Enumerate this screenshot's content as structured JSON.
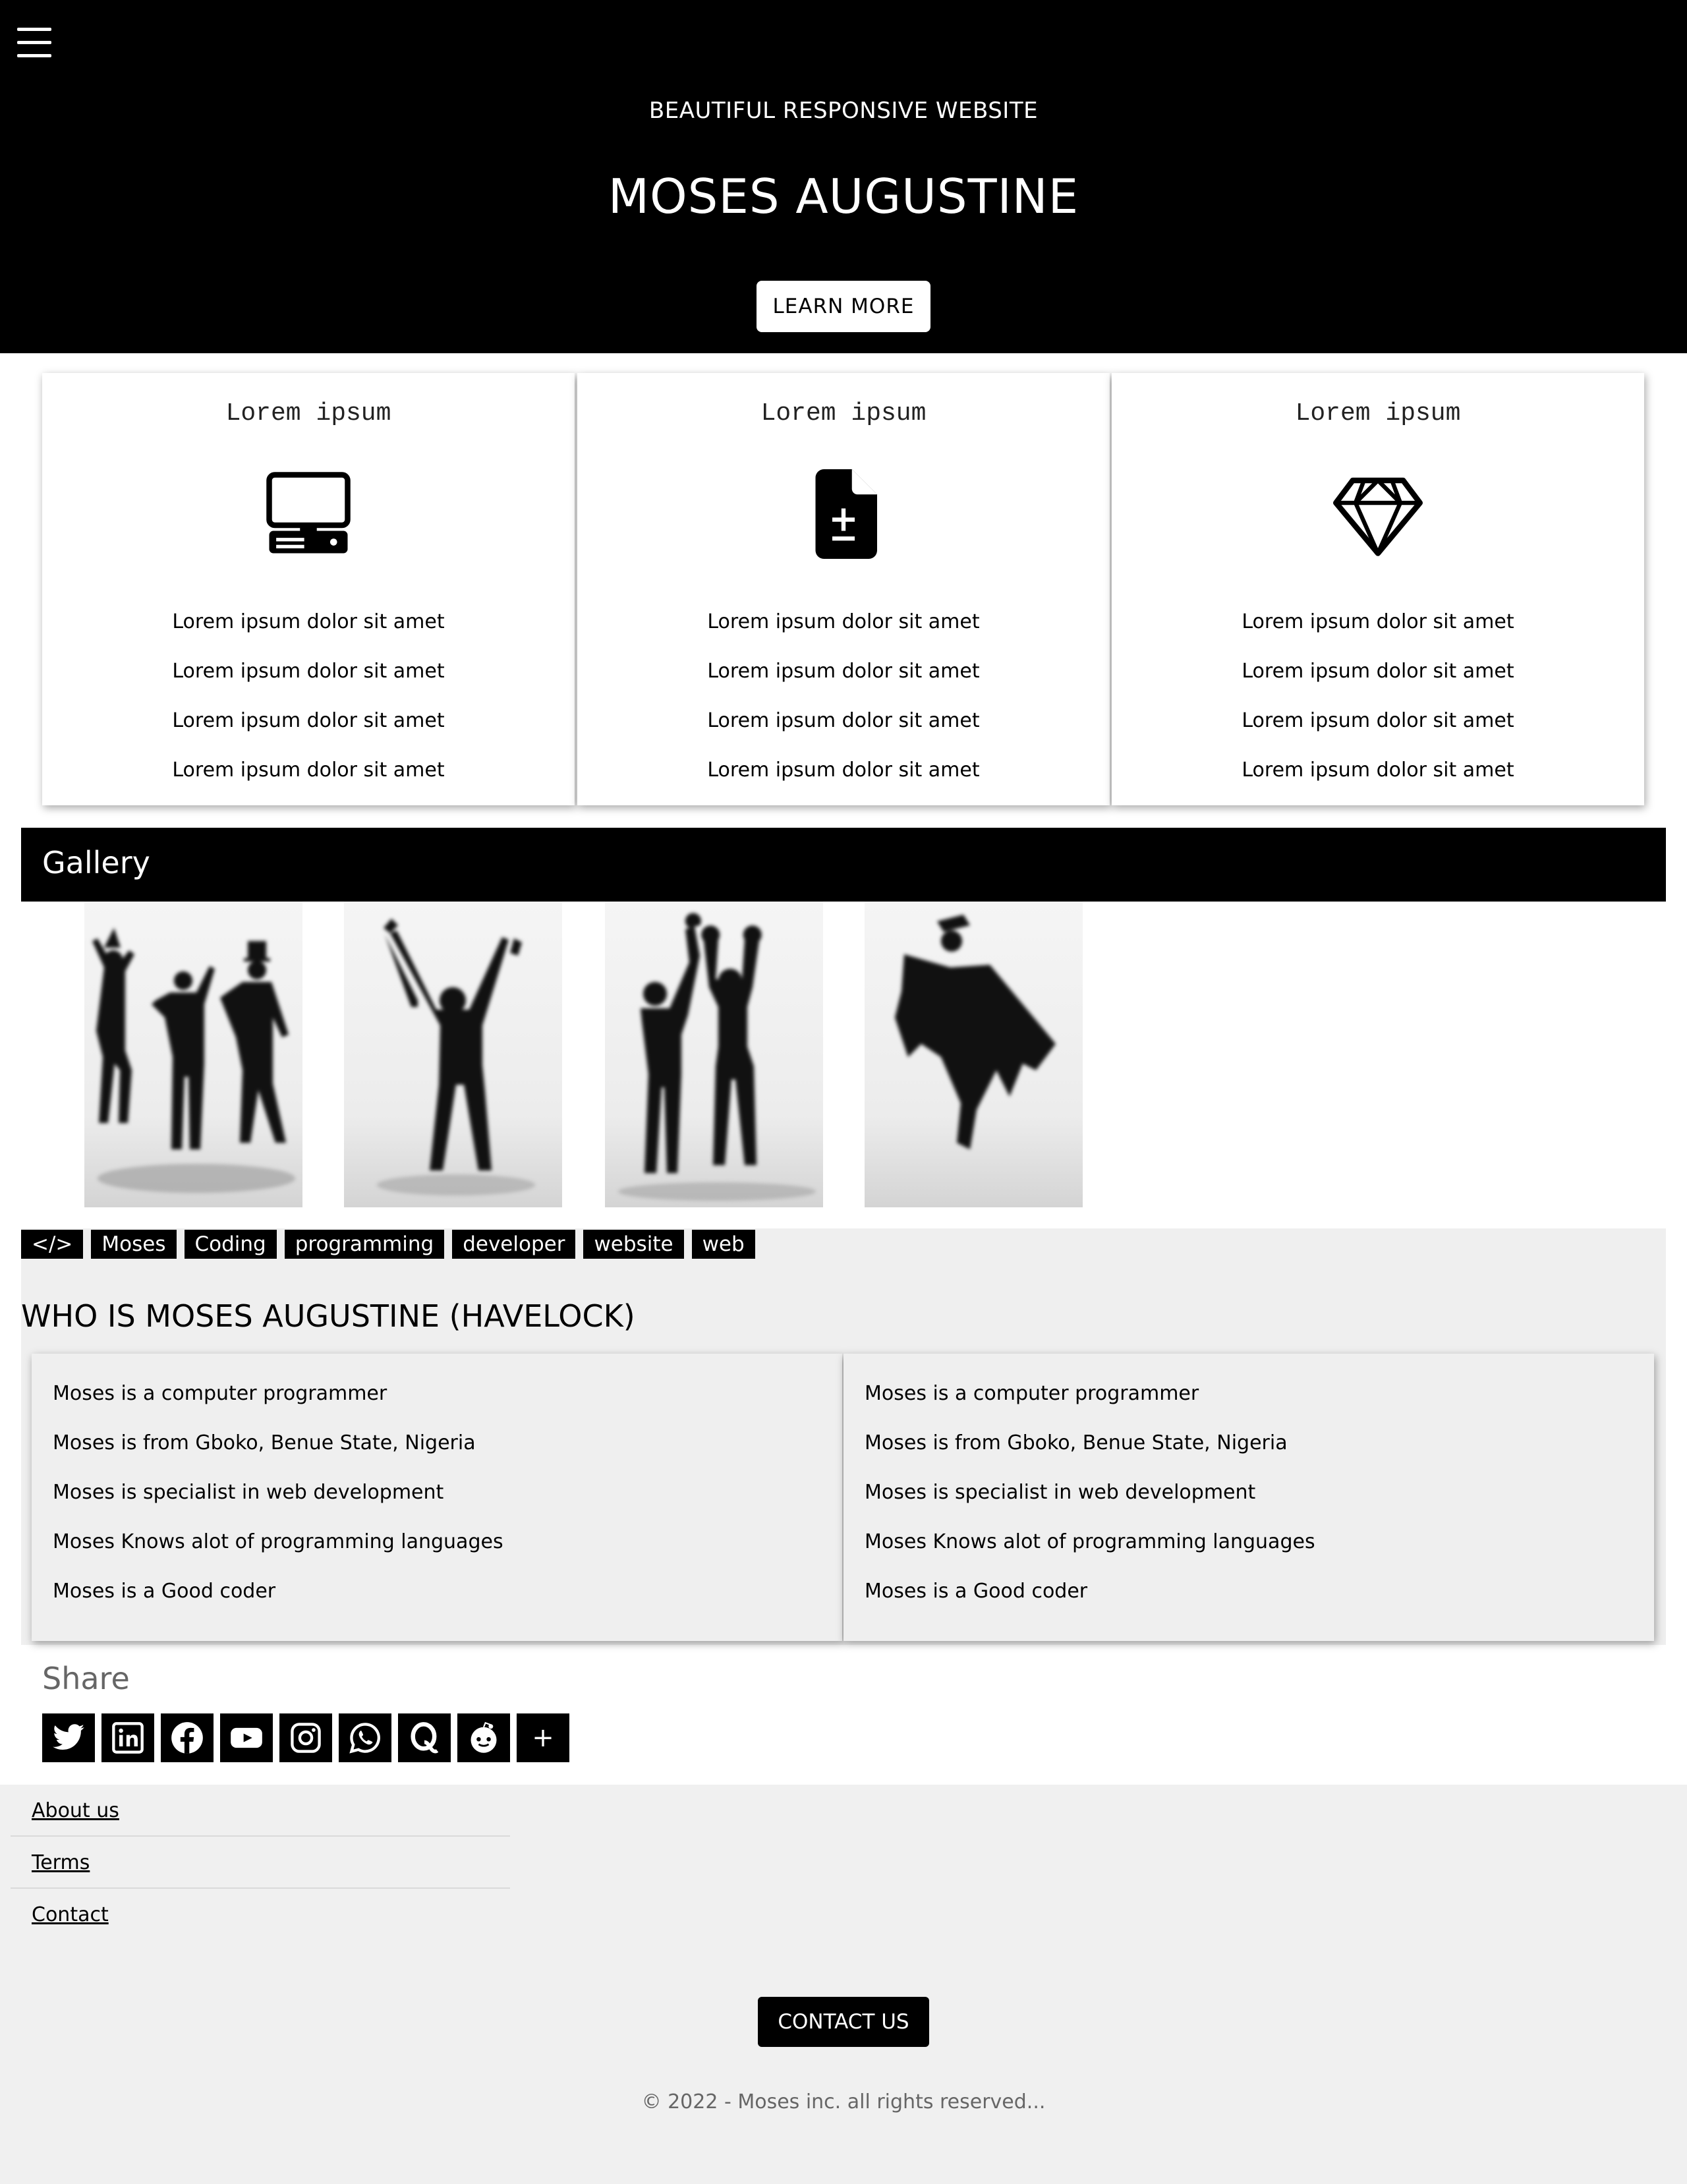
{
  "hero": {
    "subtitle": "BEAUTIFUL RESPONSIVE WEBSITE",
    "title": "MOSES AUGUSTINE",
    "button_label": "LEARN MORE",
    "menu_icon": "hamburger-icon"
  },
  "cards": [
    {
      "title": "Lorem ipsum",
      "icon": "desktop-computer-icon",
      "lines": [
        "Lorem ipsum dolor sit amet",
        "Lorem ipsum dolor sit amet",
        "Lorem ipsum dolor sit amet",
        "Lorem ipsum dolor sit amet"
      ]
    },
    {
      "title": "Lorem ipsum",
      "icon": "file-plus-minus-icon",
      "lines": [
        "Lorem ipsum dolor sit amet",
        "Lorem ipsum dolor sit amet",
        "Lorem ipsum dolor sit amet",
        "Lorem ipsum dolor sit amet"
      ]
    },
    {
      "title": "Lorem ipsum",
      "icon": "diamond-icon",
      "lines": [
        "Lorem ipsum dolor sit amet",
        "Lorem ipsum dolor sit amet",
        "Lorem ipsum dolor sit amet",
        "Lorem ipsum dolor sit amet"
      ]
    }
  ],
  "gallery": {
    "title": "Gallery",
    "photos": [
      "celebrating-group-silhouette",
      "trophy-raise-silhouette",
      "boxers-victory-silhouette",
      "graduate-jump-silhouette"
    ]
  },
  "tags": [
    "</>",
    "Moses",
    "Coding",
    "programming",
    "developer",
    "website",
    "web"
  ],
  "about": {
    "heading": "WHO IS MOSES AUGUSTINE (HAVELOCK)",
    "columns": [
      [
        "Moses is a computer programmer",
        "Moses is from Gboko, Benue State, Nigeria",
        "Moses is specialist in web development",
        "Moses Knows alot of programming languages",
        "Moses is a Good coder"
      ],
      [
        "Moses is a computer programmer",
        "Moses is from Gboko, Benue State, Nigeria",
        "Moses is specialist in web development",
        "Moses Knows alot of programming languages",
        "Moses is a Good coder"
      ]
    ]
  },
  "share": {
    "label": "Share",
    "buttons": [
      "twitter-icon",
      "linkedin-icon",
      "facebook-icon",
      "youtube-icon",
      "instagram-icon",
      "whatsapp-icon",
      "quora-icon",
      "reddit-icon",
      "plus-icon"
    ],
    "plus_label": "+"
  },
  "footer": {
    "links": [
      "About us",
      "Terms",
      "Contact"
    ],
    "contact_button": "CONTACT US",
    "copyright": "© 2022 - Moses inc. all rights reserved..."
  },
  "colors": {
    "primary": "#000000",
    "background": "#ffffff",
    "section_bg": "#efefef",
    "muted_text": "#666666"
  }
}
